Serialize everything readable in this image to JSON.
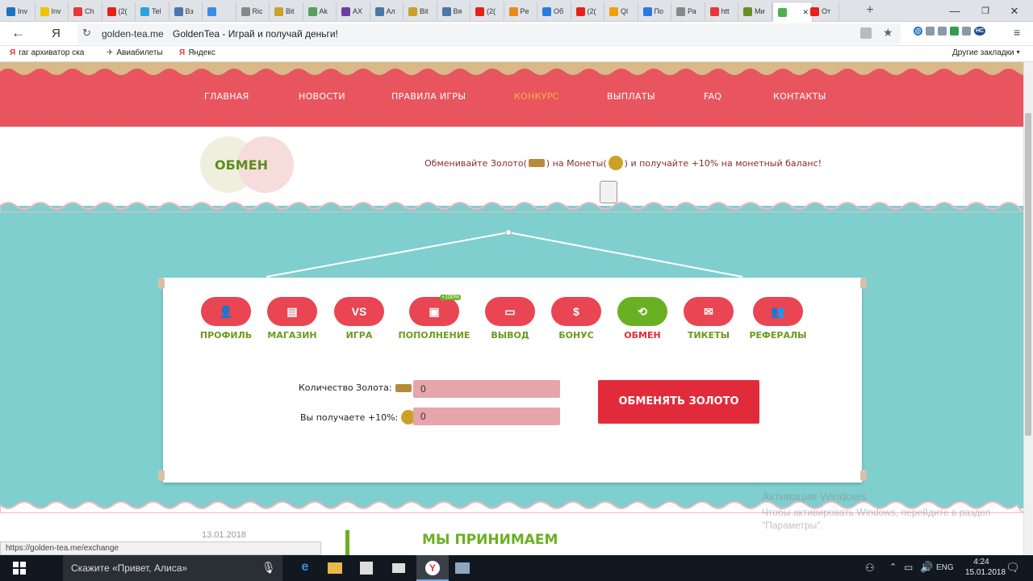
{
  "browser": {
    "tabs": [
      {
        "label": "Inv",
        "icon": "globe-icon",
        "color": "#1e73be"
      },
      {
        "label": "Inv",
        "icon": "star-icon",
        "color": "#f2c200"
      },
      {
        "label": "Ch",
        "icon": "yandex-icon",
        "color": "#e8363a"
      },
      {
        "label": "(2(",
        "icon": "youtube-icon",
        "color": "#e62117"
      },
      {
        "label": "Tel",
        "icon": "telegram-icon",
        "color": "#2aa3dd"
      },
      {
        "label": "Вз",
        "icon": "vk-icon",
        "color": "#4a76a8"
      },
      {
        "label": "",
        "icon": "plane-icon",
        "color": "#3a8ee6"
      },
      {
        "label": "Ric",
        "icon": "page-icon",
        "color": "#888888"
      },
      {
        "label": "Bit",
        "icon": "bitcoin-icon",
        "color": "#c9a227"
      },
      {
        "label": "Ak",
        "icon": "page-icon",
        "color": "#5aa05a"
      },
      {
        "label": "AX",
        "icon": "triangle-icon",
        "color": "#6b3fa0"
      },
      {
        "label": "Ал",
        "icon": "vk-icon",
        "color": "#4a76a8"
      },
      {
        "label": "Bit",
        "icon": "bitcoin-icon",
        "color": "#c9a227"
      },
      {
        "label": "Вя",
        "icon": "vk-icon",
        "color": "#4a76a8"
      },
      {
        "label": "(2(",
        "icon": "youtube-icon",
        "color": "#e62117"
      },
      {
        "label": "Pe",
        "icon": "page-icon",
        "color": "#e88a1a"
      },
      {
        "label": "Об",
        "icon": "arrow-icon",
        "color": "#2a7ae2"
      },
      {
        "label": "(2(",
        "icon": "youtube-icon",
        "color": "#e62117"
      },
      {
        "label": "Ql",
        "icon": "circle-icon",
        "color": "#f0a000"
      },
      {
        "label": "По",
        "icon": "globe-icon",
        "color": "#2a7ae2"
      },
      {
        "label": "Ра",
        "icon": "page-icon",
        "color": "#888888"
      },
      {
        "label": "htt",
        "icon": "yandex-icon",
        "color": "#e8363a"
      },
      {
        "label": "Ми",
        "icon": "page-icon",
        "color": "#6b8e23"
      },
      {
        "label": "",
        "icon": "tea-leaf-icon",
        "color": "#4caf50"
      },
      {
        "label": "От",
        "icon": "power-icon",
        "color": "#e62117"
      }
    ],
    "yandex_glyph": "Я",
    "url_domain": "golden-tea.me",
    "url_title": "GoldenTea - Играй и получай деньги!",
    "bookmarks": [
      {
        "label": "гаг архиватор ска",
        "icon": "yandex-icon"
      },
      {
        "label": "Авиабилеты",
        "icon": "plane-icon"
      },
      {
        "label": "Яндекс",
        "icon": "yandex-icon"
      }
    ],
    "other_bookmarks": "Другие закладки",
    "extensions": [
      "@",
      "НС"
    ],
    "status_url": "https://golden-tea.me/exchange"
  },
  "site": {
    "nav": [
      "ГЛАВНАЯ",
      "НОВОСТИ",
      "ПРАВИЛА ИГРЫ",
      "КОНКУРС",
      "ВЫПЛАТЫ",
      "FAQ",
      "КОНТАКТЫ"
    ],
    "nav_active_index": 3,
    "section_title": "ОБМЕН",
    "exchange_hint_pre": "Обменивайте Золото(",
    "exchange_hint_mid": ") на Монеты(",
    "exchange_hint_post": ") и получайте +10% на монетный баланс!",
    "menu": [
      {
        "label": "ПРОФИЛЬ",
        "icon": "profile-icon",
        "glyph": "👤"
      },
      {
        "label": "МАГАЗИН",
        "icon": "shop-icon",
        "glyph": "▤"
      },
      {
        "label": "ИГРА",
        "icon": "game-icon",
        "glyph": "VS"
      },
      {
        "label": "ПОПОЛНЕНИЕ",
        "icon": "deposit-icon",
        "glyph": "▣",
        "badge": "+100%"
      },
      {
        "label": "ВЫВОД",
        "icon": "wallet-icon",
        "glyph": "▭"
      },
      {
        "label": "БОНУС",
        "icon": "bonus-icon",
        "glyph": "$"
      },
      {
        "label": "ОБМЕН",
        "icon": "exchange-icon",
        "glyph": "⟲"
      },
      {
        "label": "ТИКЕТЫ",
        "icon": "tickets-icon",
        "glyph": "✉"
      },
      {
        "label": "РЕФЕРАЛЫ",
        "icon": "referrals-icon",
        "glyph": "👥"
      }
    ],
    "active_menu_color": "#6ab023",
    "menu_color": "#e94552",
    "gold_amount_label": "Количество Золота:",
    "gold_amount_value": "0",
    "receive_label": "Вы получаете +10%:",
    "receive_value": "0",
    "exchange_button": "ОБМЕНЯТЬ ЗОЛОТО",
    "news_date": "13.01.2018",
    "we_accept": "МЫ ПРИНИМАЕМ"
  },
  "watermark": {
    "line1": "Активация Windows",
    "line2": "Чтобы активировать Windows, перейдите в раздел",
    "line3": "\"Параметры\"."
  },
  "taskbar": {
    "search_placeholder": "Скажите «Привет, Алиса»",
    "lang": "ENG",
    "time": "4:24",
    "date": "15.01.2018"
  }
}
